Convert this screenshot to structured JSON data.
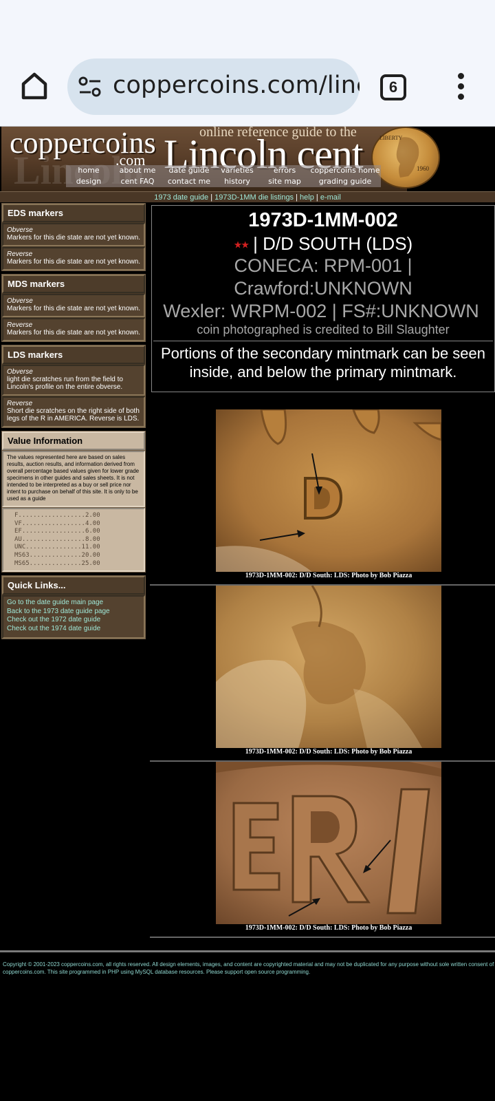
{
  "browser": {
    "url": "coppercoins.com/lincc",
    "tab_count": "6"
  },
  "banner": {
    "site_name": "coppercoins",
    "site_com": ".com",
    "tagline": "online reference guide to the",
    "title": "Lincoln cent",
    "coin_liberty": "LIBERTY",
    "coin_year": "1960",
    "nav": [
      "home",
      "about me",
      "date guide",
      "varieties",
      "errors",
      "coppercoins home",
      "design",
      "cent FAQ",
      "contact me",
      "history",
      "site map",
      "grading guide"
    ]
  },
  "subnav": {
    "link1": "1973 date guide",
    "sep1": " | ",
    "link2": "1973D-1MM die listings",
    "sep2": " | ",
    "link3": "help",
    "sep3": " | ",
    "link4": "e-mail"
  },
  "sidebar": {
    "eds": {
      "title": "EDS markers",
      "obverse_label": "Obverse",
      "obverse_text": "Markers for this die state are not yet known.",
      "reverse_label": "Reverse",
      "reverse_text": "Markers for this die state are not yet known."
    },
    "mds": {
      "title": "MDS markers",
      "obverse_label": "Obverse",
      "obverse_text": "Markers for this die state are not yet known.",
      "reverse_label": "Reverse",
      "reverse_text": "Markers for this die state are not yet known."
    },
    "lds": {
      "title": "LDS markers",
      "obverse_label": "Obverse",
      "obverse_text": "light die scratches run from the field to Lincoln's profile on the entire obverse.",
      "reverse_label": "Reverse",
      "reverse_text": "Short die scratches on the right side of both legs of the R in AMERICA. Reverse is LDS."
    },
    "value": {
      "title": "Value Information",
      "text": "The values represented here are based on sales results, auction results, and information derived from overall percentage based values given for lower grade specimens in other guides and sales sheets. It is not intended to be interpreted as a buy or sell price nor intent to purchase on behalf of this site. It is only to be used as a guide",
      "prices": [
        "F..................2.00",
        "VF.................4.00",
        "EF.................6.00",
        "AU.................8.00",
        "UNC...............11.00",
        "MS63..............20.00",
        "MS65..............25.00"
      ]
    },
    "quick": {
      "title": "Quick Links...",
      "links": [
        "Go to the date guide main page",
        "Back to the 1973 date guide page",
        "Check out the 1972 date guide",
        "Check out the 1974 date guide"
      ]
    }
  },
  "main": {
    "title": "1973D-1MM-002",
    "stars": "★★",
    "subtitle": " | D/D SOUTH (LDS)",
    "conneca": "CONECA: RPM-001  |",
    "crawford": "Crawford:UNKNOWN",
    "wexler": "Wexler: WRPM-002  |  FS#:UNKNOWN",
    "credit": "coin photographed is credited to Bill Slaughter",
    "description": "Portions of the secondary mintmark can be seen inside, and below the primary mintmark."
  },
  "photos": [
    {
      "caption": "1973D-1MM-002:  D/D South:  LDS:  Photo by Bob Piazza"
    },
    {
      "caption": "1973D-1MM-002:  D/D South:  LDS:  Photo by Bob Piazza"
    },
    {
      "caption": "1973D-1MM-002:  D/D South:  LDS:  Photo by Bob Piazza"
    }
  ],
  "footer": {
    "text": "Copyright © 2001-2023 coppercoins.com, all rights reserved. All design elements, images, and content are copyrighted material and may not be duplicated for any purpose without sole written consent of coppercoins.com. This site programmed in PHP using MySQL database resources. Please support open source programming."
  }
}
